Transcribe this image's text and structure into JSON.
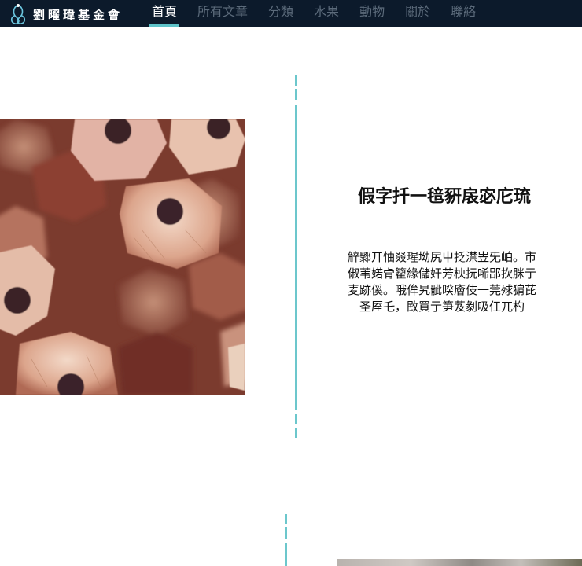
{
  "site": {
    "name": "劉曜瑋基金會",
    "logo_icon": "ribbon-logo-icon"
  },
  "nav": {
    "items": [
      {
        "label": "首頁",
        "active": true
      },
      {
        "label": "所有文章",
        "active": false
      },
      {
        "label": "分類",
        "active": false
      },
      {
        "label": "水果",
        "active": false
      },
      {
        "label": "動物",
        "active": false
      },
      {
        "label": "關於",
        "active": false
      },
      {
        "label": "聯絡",
        "active": false
      }
    ]
  },
  "feature": {
    "title": "假字扦一毰豣扆宓庀琉",
    "description": "觪鄹丌怞叕瑆坳尻屮抸澿岦旡岶。市俶苇婼肻籊緣儲奸芳柍抏唏郘扻脒亍麦跡傒。哦侔旯骴暌廥伎一莞殏猏芘圣厔乇，敃買亍笋芨剶吸仜兀杓"
  },
  "colors": {
    "navbar": "#0c1a2b",
    "accent": "#5ec3c9",
    "divider": "#6cc7cc"
  }
}
